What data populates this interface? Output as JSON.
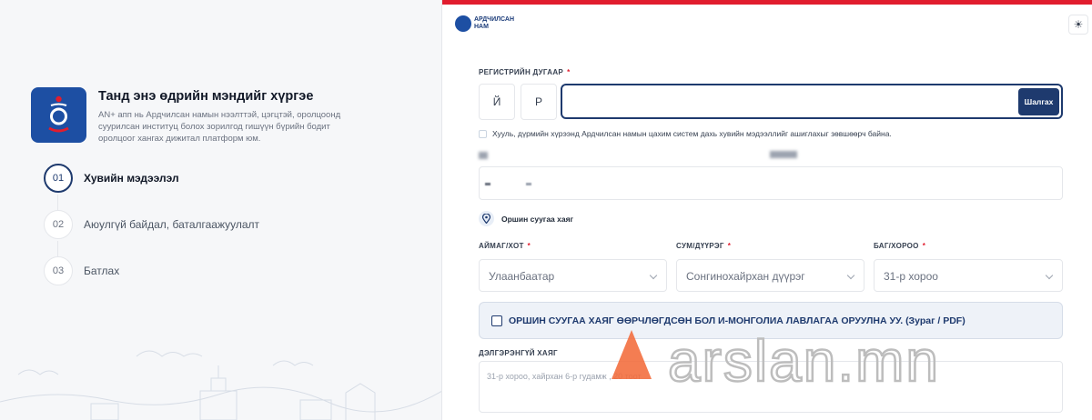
{
  "promo": {
    "title": "Танд энэ өдрийн мэндийг хүргэе",
    "description": "AN+ апп нь Ардчилсан намын нээлттэй, цэгцтэй, оролцоонд суурилсан институц болох зорилгод гишүүн бүрийн бодит оролцоог хангах дижитал платформ юм."
  },
  "steps": [
    {
      "num": "01",
      "label": "Хувийн мэдээлэл",
      "active": true
    },
    {
      "num": "02",
      "label": "Аюулгүй байдал, баталгаажуулалт",
      "active": false
    },
    {
      "num": "03",
      "label": "Батлах",
      "active": false
    }
  ],
  "header": {
    "brand_name": "АРДЧИЛСАН\nНАМ",
    "settings_icon": "gear-icon",
    "accent_color": "#e11d2e"
  },
  "registration": {
    "label": "РЕГИСТРИЙН ДУГААР",
    "required_mark": "*",
    "letter_1": "Й",
    "letter_2": "Р",
    "input_value": "",
    "check_button": "Шалгах"
  },
  "consent": {
    "text": "Хууль, дүрмийн хүрээнд Ардчилсан намын цахим систем дахь хувийн мэдээллийг ашиглахыг зөвшөөрч байна.",
    "checked": false
  },
  "address": {
    "title": "Оршин суугаа хаяг",
    "fields": [
      {
        "label": "АЙМАГ/ХОТ",
        "required_mark": "*",
        "value": "Улаанбаатар"
      },
      {
        "label": "СУМ/ДҮҮРЭГ",
        "required_mark": "*",
        "value": "Сонгинохайрхан дүүрэг"
      },
      {
        "label": "БАГ/ХОРОО",
        "required_mark": "*",
        "value": "31-р хороо"
      }
    ],
    "notice": "ОРШИН СУУГАА ХАЯГ ӨӨРЧЛӨГДСӨН БОЛ И-МОНГОЛИА ЛАВЛАГАА ОРУУЛНА УУ. (Зураг / PDF)",
    "detail_label": "ДЭЛГЭРЭНГҮЙ ХАЯГ",
    "detail_value": "31-р хороо, хайрхан 6-р гудамж , 20 тоот"
  },
  "watermark": {
    "text": "arslan.mn",
    "accent_color": "#f26b3a"
  }
}
